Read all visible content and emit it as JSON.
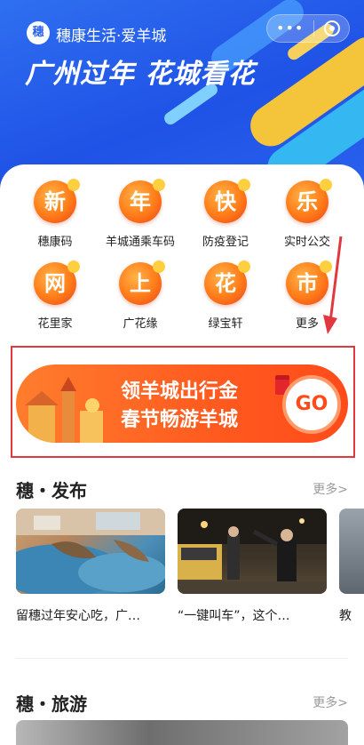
{
  "header": {
    "logo_text": "穗",
    "app_name": "穗康生活·爱羊城",
    "headline": "广州过年 花城看花",
    "menu_dots": "•••"
  },
  "services": [
    {
      "glyph": "新",
      "label": "穗康码"
    },
    {
      "glyph": "年",
      "label": "羊城通乘车码"
    },
    {
      "glyph": "快",
      "label": "防疫登记"
    },
    {
      "glyph": "乐",
      "label": "实时公交"
    },
    {
      "glyph": "网",
      "label": "花里家"
    },
    {
      "glyph": "上",
      "label": "广花缘"
    },
    {
      "glyph": "花",
      "label": "绿宝轩"
    },
    {
      "glyph": "市",
      "label": "更多"
    }
  ],
  "banner": {
    "line1": "领羊城出行金",
    "line2": "春节畅游羊城",
    "go": "GO"
  },
  "section_release": {
    "title": "穗・发布",
    "more": "更多>",
    "items": [
      {
        "caption": "留穗过年安心吃，广…"
      },
      {
        "caption": "“一键叫车”，这个…"
      },
      {
        "caption": "教"
      }
    ]
  },
  "section_tour": {
    "title": "穗・旅游",
    "more": "更多>"
  },
  "colors": {
    "header_blue": "#2a63ee",
    "accent_orange": "#ff5a1f",
    "highlight_red": "#e0383e"
  }
}
